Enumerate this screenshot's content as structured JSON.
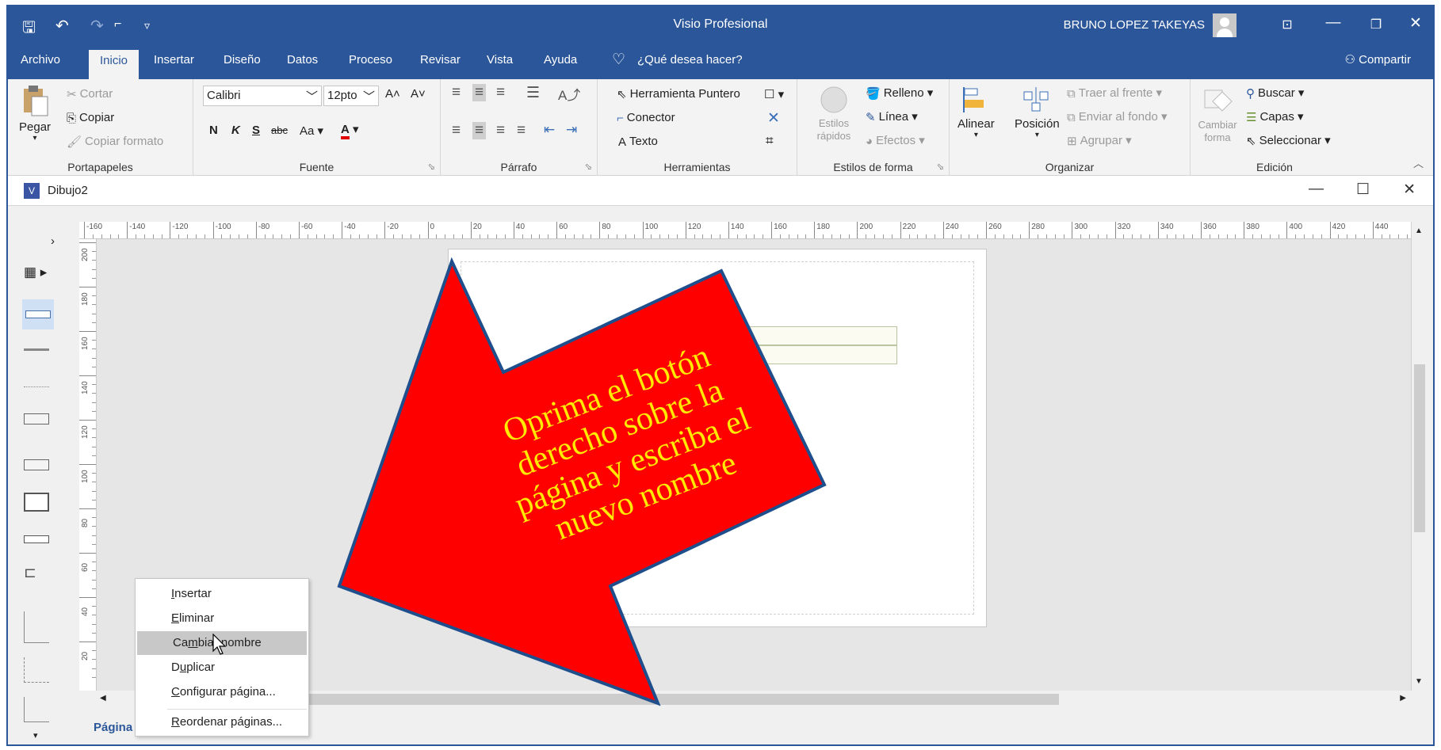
{
  "window": {
    "title": "Visio Profesional",
    "user": "BRUNO LOPEZ TAKEYAS",
    "share": "Compartir"
  },
  "tabs": [
    "Archivo",
    "Inicio",
    "Insertar",
    "Diseño",
    "Datos",
    "Proceso",
    "Revisar",
    "Vista",
    "Ayuda"
  ],
  "tellme": "¿Qué desea hacer?",
  "ribbon": {
    "clipboard": {
      "label": "Portapapeles",
      "paste": "Pegar",
      "cut": "Cortar",
      "copy": "Copiar",
      "format_painter": "Copiar formato"
    },
    "font": {
      "label": "Fuente",
      "family": "Calibri",
      "size": "12pto",
      "bold": "N",
      "italic": "K",
      "underline": "S",
      "strike": "abc",
      "case": "Aa"
    },
    "paragraph": {
      "label": "Párrafo"
    },
    "tools": {
      "label": "Herramientas",
      "pointer": "Herramienta Puntero",
      "connector": "Conector",
      "text": "Texto"
    },
    "shape_styles": {
      "label": "Estilos de forma",
      "quick_styles": "Estilos rápidos",
      "fill": "Relleno",
      "line": "Línea",
      "effects": "Efectos"
    },
    "arrange": {
      "label": "Organizar",
      "align": "Alinear",
      "position": "Posición",
      "bring_front": "Traer al frente",
      "send_back": "Enviar al fondo",
      "group": "Agrupar"
    },
    "editing": {
      "label": "Edición",
      "change_shape": "Cambiar forma",
      "find": "Buscar",
      "layers": "Capas",
      "select": "Seleccionar"
    }
  },
  "document": {
    "name": "Dibujo2"
  },
  "ruler": {
    "h": [
      "-160",
      "-140",
      "-120",
      "-100",
      "-80",
      "-60",
      "-40",
      "-20",
      "0",
      "20",
      "40",
      "60",
      "80",
      "100",
      "120",
      "140",
      "160",
      "180",
      "200",
      "220",
      "240",
      "260",
      "280",
      "300",
      "320",
      "340",
      "360",
      "380",
      "400",
      "420",
      "440"
    ],
    "v": [
      "200",
      "180",
      "160",
      "140",
      "120",
      "100",
      "80",
      "60",
      "40",
      "20"
    ]
  },
  "page_tab": "Página",
  "context_menu": {
    "items": [
      {
        "pre": "",
        "key": "I",
        "post": "nsertar"
      },
      {
        "pre": "",
        "key": "E",
        "post": "liminar"
      },
      {
        "pre": "Ca",
        "key": "m",
        "post": "biar nombre"
      },
      {
        "pre": "D",
        "key": "u",
        "post": "plicar"
      },
      {
        "pre": "",
        "key": "C",
        "post": "onfigurar página..."
      },
      {
        "pre": "",
        "key": "R",
        "post": "eordenar páginas..."
      }
    ],
    "highlighted": 2
  },
  "annotation": {
    "lines": [
      "Oprima el botón",
      "derecho sobre la",
      "página y escriba el",
      "nuevo nombre"
    ],
    "fill": "#ff0000",
    "text_color": "#ffea00",
    "stroke": "#1f4e8c"
  },
  "colors": {
    "accent": "#2b579a"
  }
}
